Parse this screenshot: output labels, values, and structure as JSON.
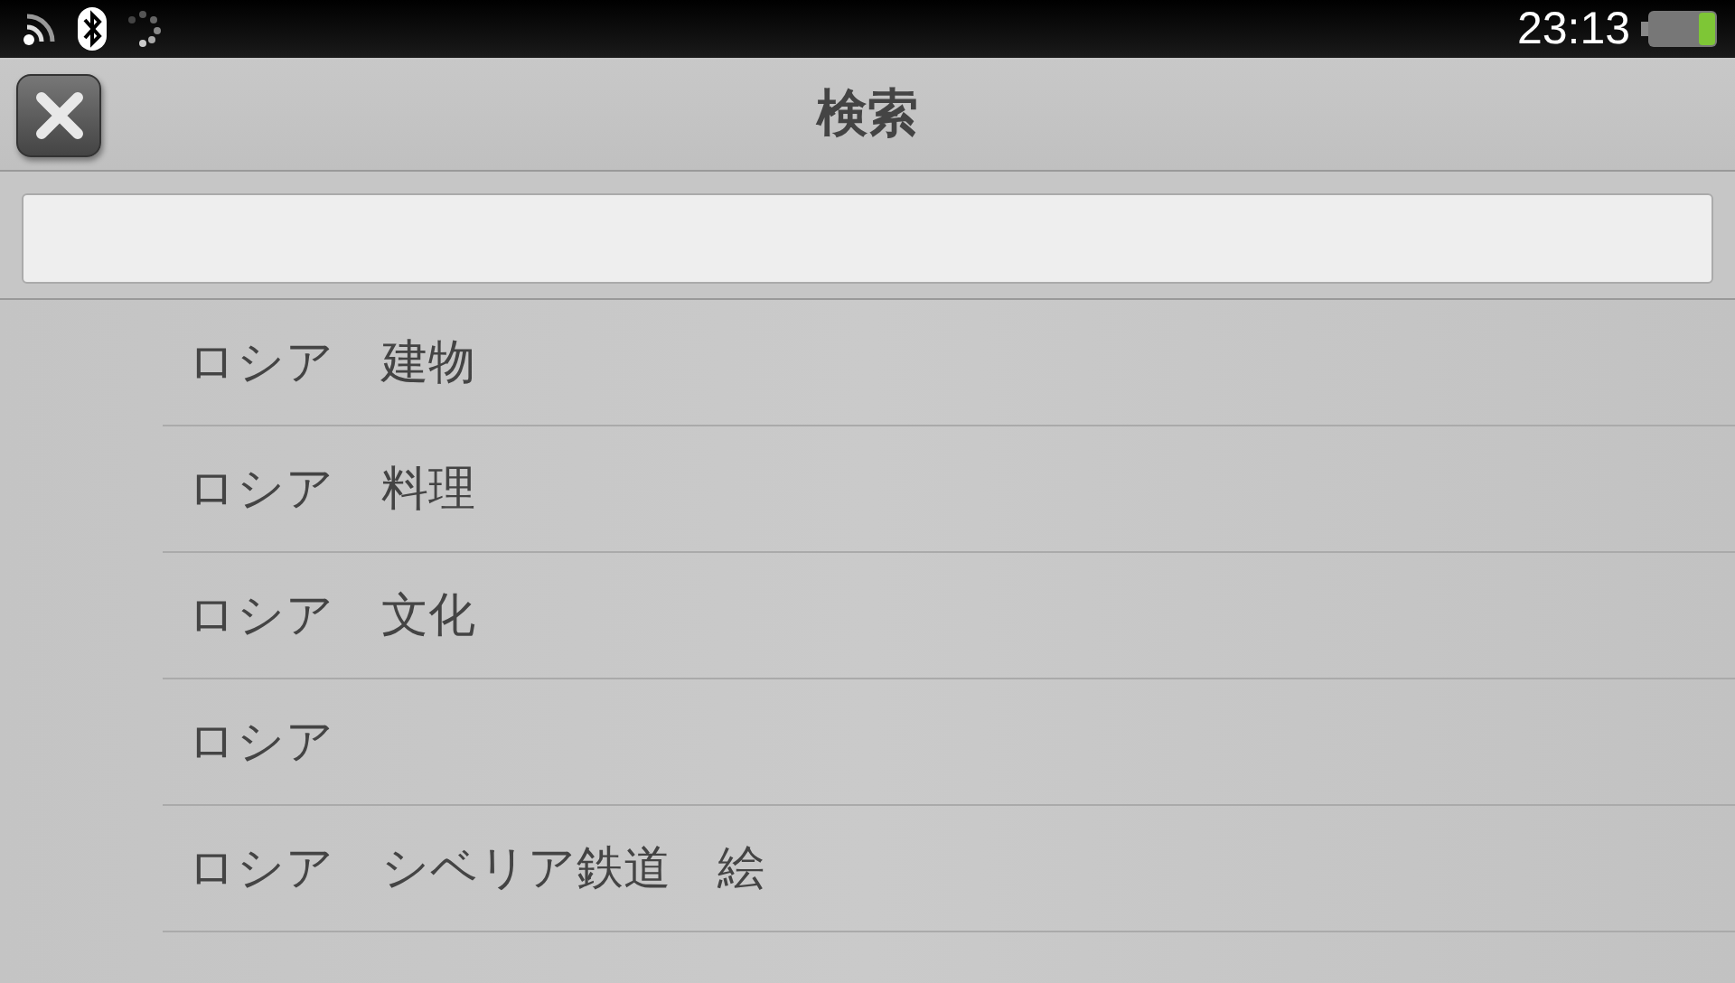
{
  "status_bar": {
    "time": "23:13"
  },
  "header": {
    "title": "検索"
  },
  "results": [
    {
      "label": "ロシア　建物"
    },
    {
      "label": "ロシア　料理"
    },
    {
      "label": "ロシア　文化"
    },
    {
      "label": "ロシア"
    },
    {
      "label": "ロシア　シベリア鉄道　絵"
    }
  ]
}
